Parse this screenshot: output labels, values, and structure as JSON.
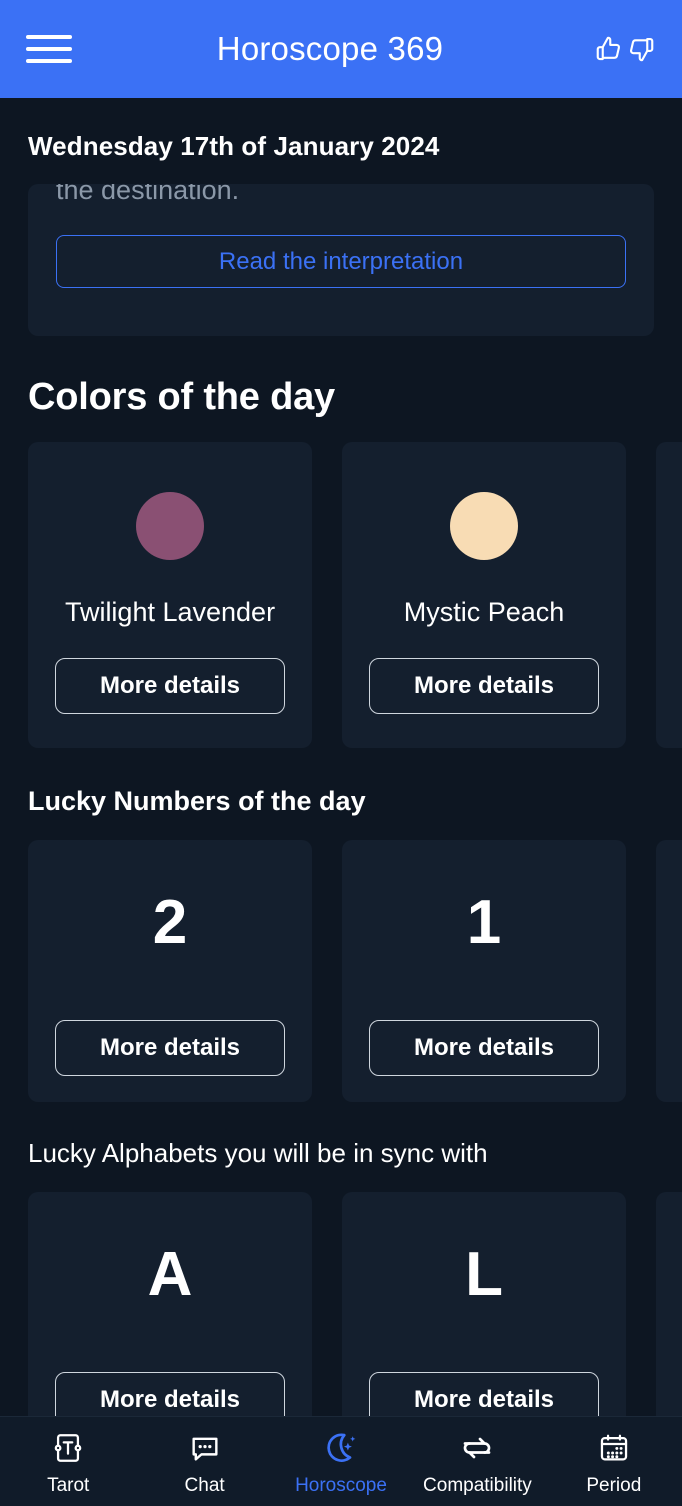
{
  "header": {
    "menu_icon": "hamburger-menu-icon",
    "title": "Horoscope 369",
    "thumbs_up_icon": "thumbs-up-icon",
    "thumbs_down_icon": "thumbs-down-icon",
    "background_color": "#3b71f5"
  },
  "page": {
    "background_color": "#0d1622",
    "card_color": "#141f2e",
    "accent_color": "#3b71f5",
    "date": "Wednesday 17th of January 2024"
  },
  "interpretation": {
    "excerpt": "the destination.",
    "button_label": "Read the interpretation"
  },
  "colors_section": {
    "heading": "Colors of the day",
    "items": [
      {
        "name": "Twilight Lavender",
        "swatch": "#8a5073",
        "button_label": "More details"
      },
      {
        "name": "Mystic Peach",
        "swatch": "#f8dcb4",
        "button_label": "More details"
      },
      {
        "name": "",
        "swatch": "#141f2e",
        "button_label": ""
      }
    ]
  },
  "numbers_section": {
    "heading": "Lucky Numbers of the day",
    "items": [
      {
        "value": "2",
        "button_label": "More details"
      },
      {
        "value": "1",
        "button_label": "More details"
      },
      {
        "value": "",
        "button_label": ""
      }
    ]
  },
  "alphabets_section": {
    "heading": "Lucky Alphabets you will be in sync with",
    "items": [
      {
        "value": "A",
        "button_label": "More details"
      },
      {
        "value": "L",
        "button_label": "More details"
      },
      {
        "value": "",
        "button_label": ""
      }
    ]
  },
  "bottom_nav": {
    "active": "Horoscope",
    "items": [
      {
        "label": "Tarot",
        "icon": "tarot-card-icon"
      },
      {
        "label": "Chat",
        "icon": "chat-bubble-icon"
      },
      {
        "label": "Horoscope",
        "icon": "crescent-moon-stars-icon"
      },
      {
        "label": "Compatibility",
        "icon": "swap-arrows-icon"
      },
      {
        "label": "Period",
        "icon": "calendar-icon"
      }
    ]
  }
}
